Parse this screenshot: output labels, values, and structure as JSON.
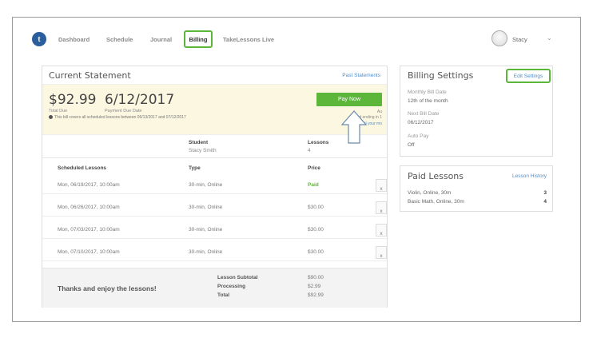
{
  "nav": {
    "logo_glyph": "t",
    "items": [
      "Dashboard",
      "Schedule",
      "Journal"
    ],
    "active": "Billing",
    "live": "TakeLessons Live",
    "user": "Stacy",
    "user_chevron": "⌄"
  },
  "statement": {
    "title": "Current Statement",
    "past_link": "Past Statements",
    "total_due": "$92.99",
    "total_due_label": "Total Due",
    "due_date": "6/12/2017",
    "due_date_label": "Payment Due Date",
    "info": "This bill covers all scheduled lessons between 06/13/2017 and 07/12/2017",
    "pay_button": "Pay Now",
    "auto_small": "Au",
    "card_ending": "Card ending in 1",
    "cancel_link": "Cancel your mo",
    "student_header": "Student",
    "student_value": "Stacy Smith",
    "lessons_header": "Lessons",
    "lessons_value": "4",
    "table_headers": [
      "Scheduled Lessons",
      "Type",
      "Price"
    ],
    "rows": [
      {
        "date": "Mon, 06/19/2017, 10:00am",
        "type": "30-min, Online",
        "price": "Paid",
        "x": "x"
      },
      {
        "date": "Mon, 06/26/2017, 10:00am",
        "type": "30-min, Online",
        "price": "$30.00",
        "x": "x"
      },
      {
        "date": "Mon, 07/03/2017, 10:00am",
        "type": "30-min, Online",
        "price": "$30.00",
        "x": "x"
      },
      {
        "date": "Mon, 07/10/2017, 10:00am",
        "type": "30-min, Online",
        "price": "$30.00",
        "x": "x"
      }
    ],
    "thanks": "Thanks and enjoy the lessons!",
    "totals": [
      {
        "label": "Lesson Subtotal",
        "value": "$90.00"
      },
      {
        "label": "Processing",
        "value": "$2.99"
      },
      {
        "label": "Total",
        "value": "$92.99"
      }
    ]
  },
  "settings": {
    "title": "Billing Settings",
    "edit": "Edit Settings",
    "monthly_label": "Monthly Bill Date",
    "monthly_value": "12th of the month",
    "next_label": "Next Bill Date",
    "next_value": "06/12/2017",
    "autopay_label": "Auto Pay",
    "autopay_value": "Off"
  },
  "paid_lessons": {
    "title": "Paid Lessons",
    "history": "Lesson History",
    "items": [
      {
        "name": "Violin, Online, 30m",
        "count": "3"
      },
      {
        "name": "Basic Math, Online, 30m",
        "count": "4"
      }
    ]
  },
  "colors": {
    "accent_green": "#5cb63a",
    "link_blue": "#4d8fd0",
    "summary_bg": "#fbf7e1"
  },
  "icons": {
    "cursor": "up-arrow-pointer-icon",
    "remove": "close-icon"
  }
}
